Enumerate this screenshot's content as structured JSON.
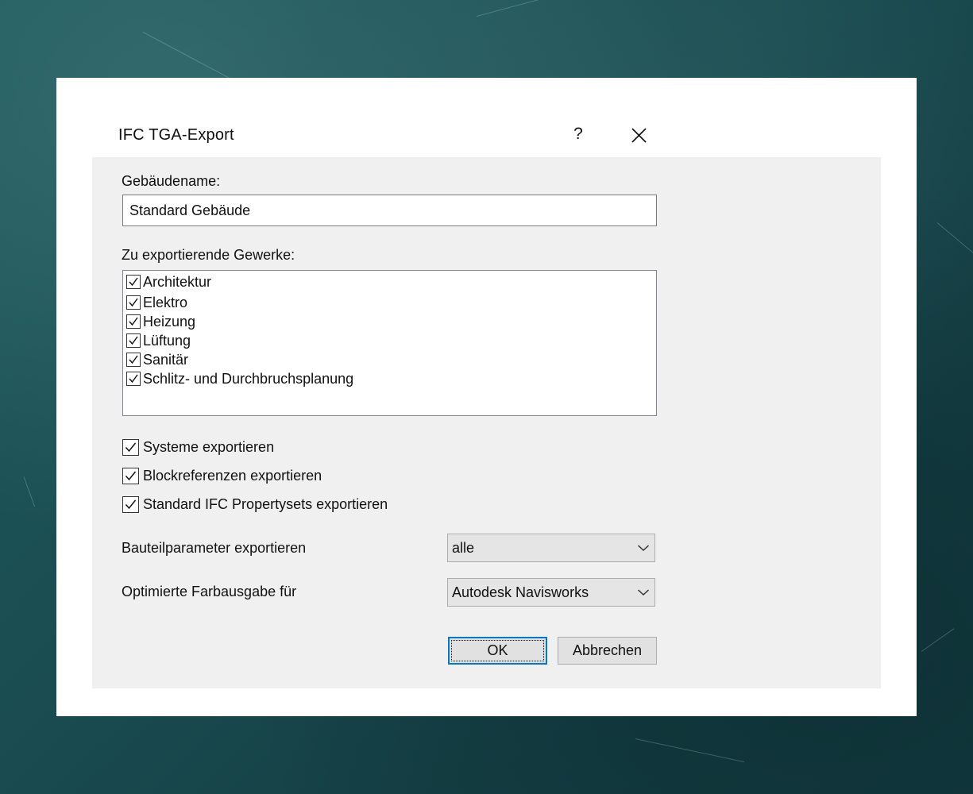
{
  "dialog": {
    "title": "IFC TGA-Export",
    "help_label": "?"
  },
  "building": {
    "label": "Gebäudename:",
    "value": "Standard Gebäude"
  },
  "trades": {
    "label": "Zu exportierende Gewerke:",
    "items": [
      {
        "label": "Architektur",
        "checked": true
      },
      {
        "label": "Elektro",
        "checked": true
      },
      {
        "label": "Heizung",
        "checked": true
      },
      {
        "label": "Lüftung",
        "checked": true
      },
      {
        "label": "Sanitär",
        "checked": true
      },
      {
        "label": "Schlitz- und Durchbruchsplanung",
        "checked": true
      }
    ]
  },
  "options": {
    "systems": {
      "label": "Systeme exportieren",
      "checked": true
    },
    "blockrefs": {
      "label": "Blockreferenzen exportieren",
      "checked": true
    },
    "propertysets": {
      "label": "Standard IFC Propertysets exportieren",
      "checked": true
    }
  },
  "component_params": {
    "label": "Bauteilparameter exportieren",
    "selected": "alle"
  },
  "color_output": {
    "label": "Optimierte Farbausgabe für",
    "selected": "Autodesk Navisworks"
  },
  "buttons": {
    "ok": "OK",
    "cancel": "Abbrechen"
  },
  "icons": {
    "close": "close-icon",
    "checkmark": "checkmark-icon",
    "dropdown": "chevron-down-icon"
  },
  "colors": {
    "background": "#1a4d52",
    "dialog_client": "#f0f0f0",
    "focus_border": "#0078d7"
  }
}
